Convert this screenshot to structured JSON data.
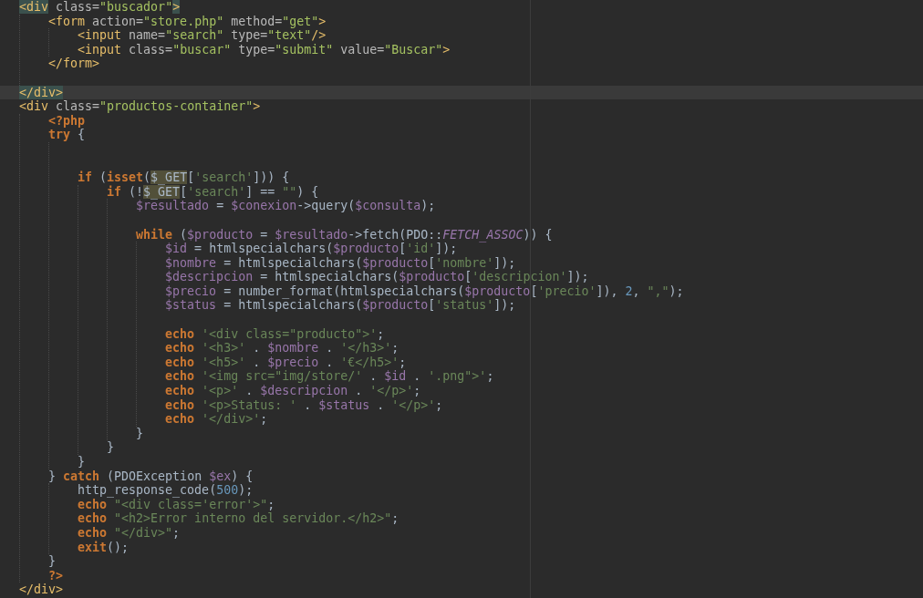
{
  "editor": {
    "lines": [
      {
        "kind": "code",
        "current": false,
        "tokens": [
          {
            "kind": "tag_match",
            "text": "<div"
          },
          {
            "kind": "attr",
            "text": " class="
          },
          {
            "kind": "value",
            "text": "\"buscador\""
          },
          {
            "kind": "tag_match",
            "text": ">"
          }
        ],
        "children": [
          {
            "kind": "code",
            "current": false,
            "tokens": [
              {
                "kind": "tag",
                "text": "<form"
              },
              {
                "kind": "attr",
                "text": " action="
              },
              {
                "kind": "value",
                "text": "\"store.php\""
              },
              {
                "kind": "attr",
                "text": " method="
              },
              {
                "kind": "value",
                "text": "\"get\""
              },
              {
                "kind": "tag",
                "text": ">"
              }
            ],
            "children": [
              {
                "kind": "code",
                "current": false,
                "tokens": [
                  {
                    "kind": "tag",
                    "text": "<input"
                  },
                  {
                    "kind": "attr",
                    "text": " name="
                  },
                  {
                    "kind": "value",
                    "text": "\"search\""
                  },
                  {
                    "kind": "attr",
                    "text": " type="
                  },
                  {
                    "kind": "value",
                    "text": "\"text\""
                  },
                  {
                    "kind": "tag",
                    "text": "/>"
                  }
                ]
              },
              {
                "kind": "code",
                "current": false,
                "tokens": [
                  {
                    "kind": "tag",
                    "text": "<input"
                  },
                  {
                    "kind": "attr",
                    "text": " class="
                  },
                  {
                    "kind": "value",
                    "text": "\"buscar\""
                  },
                  {
                    "kind": "attr",
                    "text": " type="
                  },
                  {
                    "kind": "value",
                    "text": "\"submit\""
                  },
                  {
                    "kind": "attr",
                    "text": " value="
                  },
                  {
                    "kind": "value",
                    "text": "\"Buscar\""
                  },
                  {
                    "kind": "tag",
                    "text": ">"
                  }
                ]
              }
            ]
          },
          {
            "kind": "code",
            "current": false,
            "tokens": [
              {
                "kind": "tag",
                "text": "</form>"
              }
            ]
          },
          {
            "kind": "blank",
            "current": false
          }
        ]
      },
      {
        "kind": "code",
        "current": true,
        "tokens": [
          {
            "kind": "tag_match",
            "text": "</div>"
          }
        ]
      },
      {
        "kind": "code",
        "current": false,
        "tokens": [
          {
            "kind": "tag",
            "text": "<div"
          },
          {
            "kind": "attr",
            "text": " class="
          },
          {
            "kind": "value",
            "text": "\"productos-container\""
          },
          {
            "kind": "tag",
            "text": ">"
          }
        ],
        "children": [
          {
            "kind": "code",
            "current": false,
            "tokens": [
              {
                "kind": "phptag",
                "text": "<?php"
              }
            ]
          },
          {
            "kind": "code",
            "current": false,
            "tokens": [
              {
                "kind": "keyword",
                "text": "try"
              },
              {
                "kind": "plain",
                "text": " {"
              }
            ],
            "children": [
              {
                "kind": "blank",
                "current": false
              },
              {
                "kind": "blank",
                "current": false
              },
              {
                "kind": "code",
                "current": false,
                "tokens": [
                  {
                    "kind": "keyword",
                    "text": "if"
                  },
                  {
                    "kind": "plain",
                    "text": " ("
                  },
                  {
                    "kind": "keyword",
                    "text": "isset"
                  },
                  {
                    "kind": "plain",
                    "text": "("
                  },
                  {
                    "kind": "occurrence",
                    "text": "$_GET"
                  },
                  {
                    "kind": "plain",
                    "text": "["
                  },
                  {
                    "kind": "string",
                    "text": "'search'"
                  },
                  {
                    "kind": "plain",
                    "text": "])) {"
                  }
                ],
                "children": [
                  {
                    "kind": "code",
                    "current": false,
                    "tokens": [
                      {
                        "kind": "keyword",
                        "text": "if"
                      },
                      {
                        "kind": "plain",
                        "text": " (!"
                      },
                      {
                        "kind": "occurrence",
                        "text": "$_GET"
                      },
                      {
                        "kind": "plain",
                        "text": "["
                      },
                      {
                        "kind": "string",
                        "text": "'search'"
                      },
                      {
                        "kind": "plain",
                        "text": "] == "
                      },
                      {
                        "kind": "string",
                        "text": "\"\""
                      },
                      {
                        "kind": "plain",
                        "text": ") {"
                      }
                    ],
                    "children": [
                      {
                        "kind": "code",
                        "current": false,
                        "tokens": [
                          {
                            "kind": "variable",
                            "text": "$resultado"
                          },
                          {
                            "kind": "plain",
                            "text": " = "
                          },
                          {
                            "kind": "variable",
                            "text": "$conexion"
                          },
                          {
                            "kind": "plain",
                            "text": "->query("
                          },
                          {
                            "kind": "variable",
                            "text": "$consulta"
                          },
                          {
                            "kind": "plain",
                            "text": ");"
                          }
                        ]
                      },
                      {
                        "kind": "blank",
                        "current": false
                      },
                      {
                        "kind": "code",
                        "current": false,
                        "tokens": [
                          {
                            "kind": "keyword",
                            "text": "while"
                          },
                          {
                            "kind": "plain",
                            "text": " ("
                          },
                          {
                            "kind": "variable",
                            "text": "$producto"
                          },
                          {
                            "kind": "plain",
                            "text": " = "
                          },
                          {
                            "kind": "variable",
                            "text": "$resultado"
                          },
                          {
                            "kind": "plain",
                            "text": "->fetch(PDO::"
                          },
                          {
                            "kind": "constant",
                            "text": "FETCH_ASSOC"
                          },
                          {
                            "kind": "plain",
                            "text": ")) {"
                          }
                        ],
                        "children": [
                          {
                            "kind": "code",
                            "current": false,
                            "tokens": [
                              {
                                "kind": "variable",
                                "text": "$id"
                              },
                              {
                                "kind": "plain",
                                "text": " = htmlspecialchars("
                              },
                              {
                                "kind": "variable",
                                "text": "$producto"
                              },
                              {
                                "kind": "plain",
                                "text": "["
                              },
                              {
                                "kind": "string",
                                "text": "'id'"
                              },
                              {
                                "kind": "plain",
                                "text": "]);"
                              }
                            ]
                          },
                          {
                            "kind": "code",
                            "current": false,
                            "tokens": [
                              {
                                "kind": "variable",
                                "text": "$nombre"
                              },
                              {
                                "kind": "plain",
                                "text": " = htmlspecialchars("
                              },
                              {
                                "kind": "variable",
                                "text": "$producto"
                              },
                              {
                                "kind": "plain",
                                "text": "["
                              },
                              {
                                "kind": "string",
                                "text": "'nombre'"
                              },
                              {
                                "kind": "plain",
                                "text": "]);"
                              }
                            ]
                          },
                          {
                            "kind": "code",
                            "current": false,
                            "tokens": [
                              {
                                "kind": "variable",
                                "text": "$descripcion"
                              },
                              {
                                "kind": "plain",
                                "text": " = htmlspecialchars("
                              },
                              {
                                "kind": "variable",
                                "text": "$producto"
                              },
                              {
                                "kind": "plain",
                                "text": "["
                              },
                              {
                                "kind": "string",
                                "text": "'descripcion'"
                              },
                              {
                                "kind": "plain",
                                "text": "]);"
                              }
                            ]
                          },
                          {
                            "kind": "code",
                            "current": false,
                            "tokens": [
                              {
                                "kind": "variable",
                                "text": "$precio"
                              },
                              {
                                "kind": "plain",
                                "text": " = number_format(htmlspecialchars("
                              },
                              {
                                "kind": "variable",
                                "text": "$producto"
                              },
                              {
                                "kind": "plain",
                                "text": "["
                              },
                              {
                                "kind": "string",
                                "text": "'precio'"
                              },
                              {
                                "kind": "plain",
                                "text": "]), "
                              },
                              {
                                "kind": "number",
                                "text": "2"
                              },
                              {
                                "kind": "plain",
                                "text": ", "
                              },
                              {
                                "kind": "string",
                                "text": "\",\""
                              },
                              {
                                "kind": "plain",
                                "text": ");"
                              }
                            ]
                          },
                          {
                            "kind": "code",
                            "current": false,
                            "tokens": [
                              {
                                "kind": "variable",
                                "text": "$status"
                              },
                              {
                                "kind": "plain",
                                "text": " = htmlspecialchars("
                              },
                              {
                                "kind": "variable",
                                "text": "$producto"
                              },
                              {
                                "kind": "plain",
                                "text": "["
                              },
                              {
                                "kind": "string",
                                "text": "'status'"
                              },
                              {
                                "kind": "plain",
                                "text": "]);"
                              }
                            ]
                          },
                          {
                            "kind": "blank",
                            "current": false
                          },
                          {
                            "kind": "code",
                            "current": false,
                            "tokens": [
                              {
                                "kind": "keyword",
                                "text": "echo "
                              },
                              {
                                "kind": "string",
                                "text": "'<div class=\"producto\">'"
                              },
                              {
                                "kind": "plain",
                                "text": ";"
                              }
                            ]
                          },
                          {
                            "kind": "code",
                            "current": false,
                            "tokens": [
                              {
                                "kind": "keyword",
                                "text": "echo "
                              },
                              {
                                "kind": "string",
                                "text": "'<h3>'"
                              },
                              {
                                "kind": "plain",
                                "text": " . "
                              },
                              {
                                "kind": "variable",
                                "text": "$nombre"
                              },
                              {
                                "kind": "plain",
                                "text": " . "
                              },
                              {
                                "kind": "string",
                                "text": "'</h3>'"
                              },
                              {
                                "kind": "plain",
                                "text": ";"
                              }
                            ]
                          },
                          {
                            "kind": "code",
                            "current": false,
                            "tokens": [
                              {
                                "kind": "keyword",
                                "text": "echo "
                              },
                              {
                                "kind": "string",
                                "text": "'<h5>'"
                              },
                              {
                                "kind": "plain",
                                "text": " . "
                              },
                              {
                                "kind": "variable",
                                "text": "$precio"
                              },
                              {
                                "kind": "plain",
                                "text": " . "
                              },
                              {
                                "kind": "string",
                                "text": "'€</h5>'"
                              },
                              {
                                "kind": "plain",
                                "text": ";"
                              }
                            ]
                          },
                          {
                            "kind": "code",
                            "current": false,
                            "tokens": [
                              {
                                "kind": "keyword",
                                "text": "echo "
                              },
                              {
                                "kind": "string",
                                "text": "'<img src=\"img/store/'"
                              },
                              {
                                "kind": "plain",
                                "text": " . "
                              },
                              {
                                "kind": "variable",
                                "text": "$id"
                              },
                              {
                                "kind": "plain",
                                "text": " . "
                              },
                              {
                                "kind": "string",
                                "text": "'.png\">'"
                              },
                              {
                                "kind": "plain",
                                "text": ";"
                              }
                            ]
                          },
                          {
                            "kind": "code",
                            "current": false,
                            "tokens": [
                              {
                                "kind": "keyword",
                                "text": "echo "
                              },
                              {
                                "kind": "string",
                                "text": "'<p>'"
                              },
                              {
                                "kind": "plain",
                                "text": " . "
                              },
                              {
                                "kind": "variable",
                                "text": "$descripcion"
                              },
                              {
                                "kind": "plain",
                                "text": " . "
                              },
                              {
                                "kind": "string",
                                "text": "'</p>'"
                              },
                              {
                                "kind": "plain",
                                "text": ";"
                              }
                            ]
                          },
                          {
                            "kind": "code",
                            "current": false,
                            "tokens": [
                              {
                                "kind": "keyword",
                                "text": "echo "
                              },
                              {
                                "kind": "string",
                                "text": "'<p>Status: '"
                              },
                              {
                                "kind": "plain",
                                "text": " . "
                              },
                              {
                                "kind": "variable",
                                "text": "$status"
                              },
                              {
                                "kind": "plain",
                                "text": " . "
                              },
                              {
                                "kind": "string",
                                "text": "'</p>'"
                              },
                              {
                                "kind": "plain",
                                "text": ";"
                              }
                            ]
                          },
                          {
                            "kind": "code",
                            "current": false,
                            "tokens": [
                              {
                                "kind": "keyword",
                                "text": "echo "
                              },
                              {
                                "kind": "string",
                                "text": "'</div>'"
                              },
                              {
                                "kind": "plain",
                                "text": ";"
                              }
                            ]
                          }
                        ]
                      },
                      {
                        "kind": "code",
                        "current": false,
                        "tokens": [
                          {
                            "kind": "plain",
                            "text": "}"
                          }
                        ]
                      }
                    ]
                  },
                  {
                    "kind": "code",
                    "current": false,
                    "tokens": [
                      {
                        "kind": "plain",
                        "text": "}"
                      }
                    ]
                  }
                ]
              },
              {
                "kind": "code",
                "current": false,
                "tokens": [
                  {
                    "kind": "plain",
                    "text": "}"
                  }
                ]
              }
            ]
          },
          {
            "kind": "code",
            "current": false,
            "tokens": [
              {
                "kind": "plain",
                "text": "} "
              },
              {
                "kind": "keyword",
                "text": "catch"
              },
              {
                "kind": "plain",
                "text": " (PDOException "
              },
              {
                "kind": "variable",
                "text": "$ex"
              },
              {
                "kind": "plain",
                "text": ") {"
              }
            ],
            "children": [
              {
                "kind": "code",
                "current": false,
                "tokens": [
                  {
                    "kind": "plain",
                    "text": "http_response_code("
                  },
                  {
                    "kind": "number",
                    "text": "500"
                  },
                  {
                    "kind": "plain",
                    "text": ");"
                  }
                ]
              },
              {
                "kind": "code",
                "current": false,
                "tokens": [
                  {
                    "kind": "keyword",
                    "text": "echo "
                  },
                  {
                    "kind": "string",
                    "text": "\"<div class='error'>\""
                  },
                  {
                    "kind": "plain",
                    "text": ";"
                  }
                ]
              },
              {
                "kind": "code",
                "current": false,
                "tokens": [
                  {
                    "kind": "keyword",
                    "text": "echo "
                  },
                  {
                    "kind": "string",
                    "text": "\"<h2>Error interno del servidor.</h2>\""
                  },
                  {
                    "kind": "plain",
                    "text": ";"
                  }
                ]
              },
              {
                "kind": "code",
                "current": false,
                "tokens": [
                  {
                    "kind": "keyword",
                    "text": "echo "
                  },
                  {
                    "kind": "string",
                    "text": "\"</div>\""
                  },
                  {
                    "kind": "plain",
                    "text": ";"
                  }
                ]
              },
              {
                "kind": "code",
                "current": false,
                "tokens": [
                  {
                    "kind": "keyword",
                    "text": "exit"
                  },
                  {
                    "kind": "plain",
                    "text": "();"
                  }
                ]
              }
            ]
          },
          {
            "kind": "code",
            "current": false,
            "tokens": [
              {
                "kind": "plain",
                "text": "}"
              }
            ]
          },
          {
            "kind": "code",
            "current": false,
            "tokens": [
              {
                "kind": "phptag",
                "text": "?>"
              }
            ]
          }
        ]
      },
      {
        "kind": "code",
        "current": false,
        "tokens": [
          {
            "kind": "tag",
            "text": "</div>"
          }
        ]
      }
    ]
  }
}
